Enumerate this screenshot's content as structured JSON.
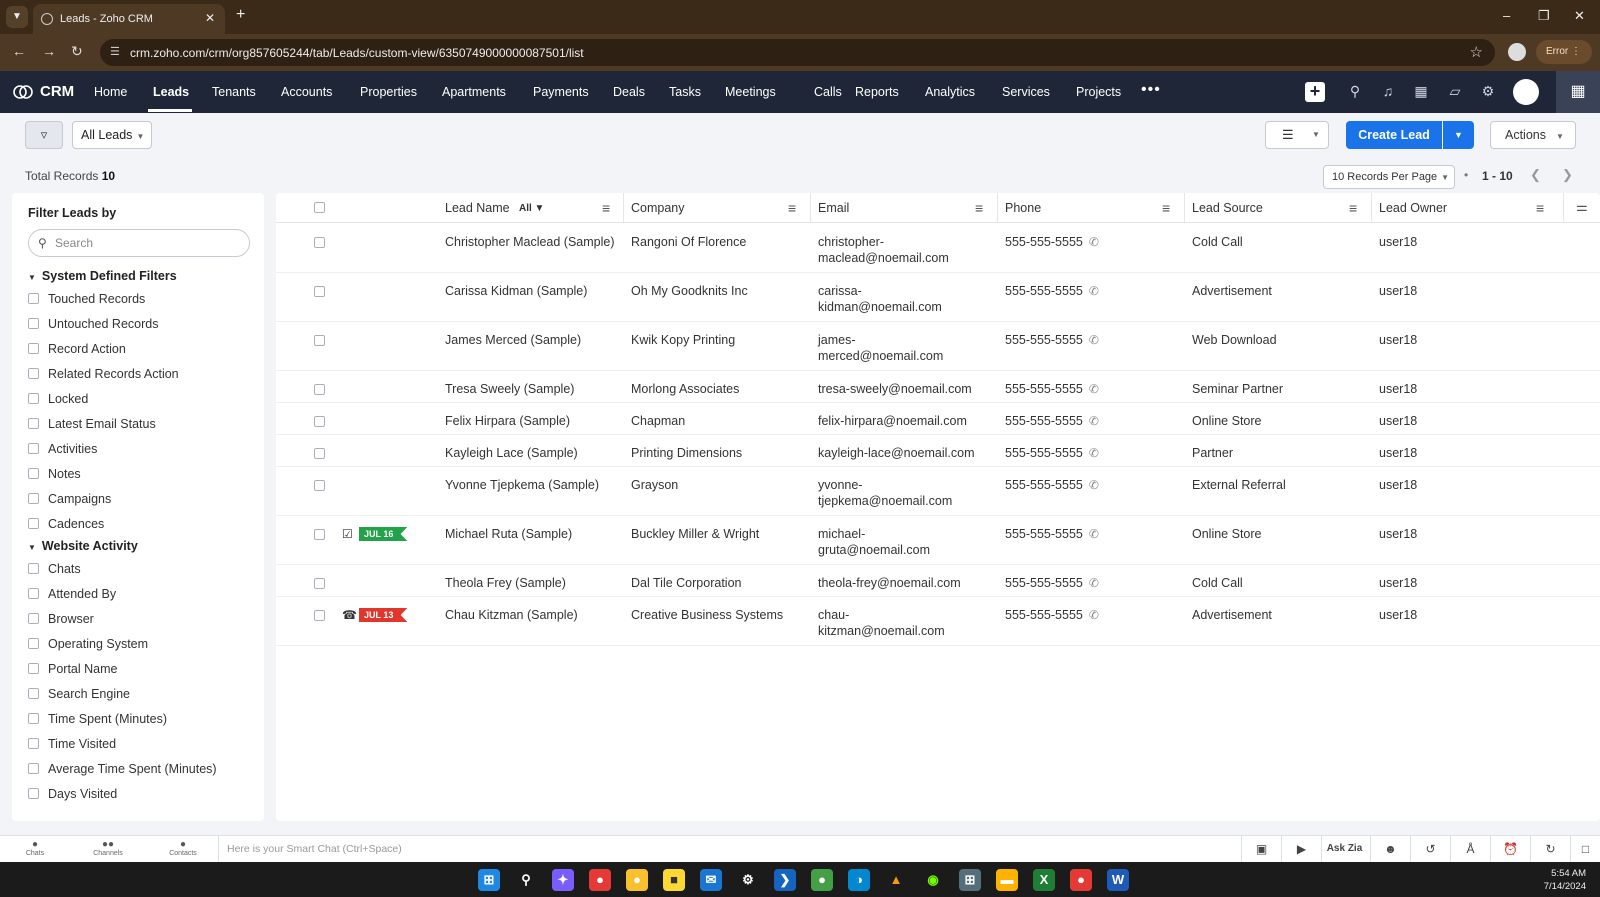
{
  "browser": {
    "tab_title": "Leads - Zoho CRM",
    "url": "crm.zoho.com/crm/org857605244/tab/Leads/custom-view/6350749000000087501/list",
    "error_label": "Error"
  },
  "crm": {
    "brand": "CRM",
    "nav": [
      {
        "label": "Home"
      },
      {
        "label": "Leads"
      },
      {
        "label": "Tenants"
      },
      {
        "label": "Accounts"
      },
      {
        "label": "Properties"
      },
      {
        "label": "Apartments"
      },
      {
        "label": "Payments"
      },
      {
        "label": "Deals"
      },
      {
        "label": "Tasks"
      },
      {
        "label": "Meetings"
      },
      {
        "label": "Calls"
      },
      {
        "label": "Reports"
      },
      {
        "label": "Analytics"
      },
      {
        "label": "Services"
      },
      {
        "label": "Projects"
      }
    ],
    "active_nav": "Leads"
  },
  "toolbar": {
    "view_label": "All Leads",
    "create_label": "Create Lead",
    "actions_label": "Actions",
    "total_label": "Total Records",
    "total_count": "10",
    "per_page": "10 Records Per Page",
    "page_range": "1 - 10"
  },
  "sidebar": {
    "title": "Filter Leads by",
    "search_placeholder": "Search",
    "sections": [
      {
        "title": "System Defined Filters",
        "items": [
          "Touched Records",
          "Untouched Records",
          "Record Action",
          "Related Records Action",
          "Locked",
          "Latest Email Status",
          "Activities",
          "Notes",
          "Campaigns",
          "Cadences"
        ]
      },
      {
        "title": "Website Activity",
        "items": [
          "Chats",
          "Attended By",
          "Browser",
          "Operating System",
          "Portal Name",
          "Search Engine",
          "Time Spent (Minutes)",
          "Time Visited",
          "Average Time Spent (Minutes)",
          "Days Visited"
        ]
      }
    ]
  },
  "table": {
    "columns": [
      "Lead Name",
      "Company",
      "Email",
      "Phone",
      "Lead Source",
      "Lead Owner"
    ],
    "name_filter": "All",
    "rows": [
      {
        "name": "Christopher Maclead (Sample)",
        "company": "Rangoni Of Florence",
        "email1": "christopher-",
        "email2": "maclead@noemail.com",
        "phone": "555-555-5555",
        "source": "Cold Call",
        "owner": "user18",
        "badge": ""
      },
      {
        "name": "Carissa Kidman (Sample)",
        "company": "Oh My Goodknits Inc",
        "email1": "carissa-",
        "email2": "kidman@noemail.com",
        "phone": "555-555-5555",
        "source": "Advertisement",
        "owner": "user18",
        "badge": ""
      },
      {
        "name": "James Merced (Sample)",
        "company": "Kwik Kopy Printing",
        "email1": "james-",
        "email2": "merced@noemail.com",
        "phone": "555-555-5555",
        "source": "Web Download",
        "owner": "user18",
        "badge": ""
      },
      {
        "name": "Tresa Sweely (Sample)",
        "company": "Morlong Associates",
        "email1": "tresa-sweely@noemail.com",
        "email2": "",
        "phone": "555-555-5555",
        "source": "Seminar Partner",
        "owner": "user18",
        "badge": ""
      },
      {
        "name": "Felix Hirpara (Sample)",
        "company": "Chapman",
        "email1": "felix-hirpara@noemail.com",
        "email2": "",
        "phone": "555-555-5555",
        "source": "Online Store",
        "owner": "user18",
        "badge": ""
      },
      {
        "name": "Kayleigh Lace (Sample)",
        "company": "Printing Dimensions",
        "email1": "kayleigh-lace@noemail.com",
        "email2": "",
        "phone": "555-555-5555",
        "source": "Partner",
        "owner": "user18",
        "badge": ""
      },
      {
        "name": "Yvonne Tjepkema (Sample)",
        "company": "Grayson",
        "email1": "yvonne-",
        "email2": "tjepkema@noemail.com",
        "phone": "555-555-5555",
        "source": "External Referral",
        "owner": "user18",
        "badge": ""
      },
      {
        "name": "Michael Ruta (Sample)",
        "company": "Buckley Miller & Wright",
        "email1": "michael-",
        "email2": "gruta@noemail.com",
        "phone": "555-555-5555",
        "source": "Online Store",
        "owner": "user18",
        "badge": "JUL 16"
      },
      {
        "name": "Theola Frey (Sample)",
        "company": "Dal Tile Corporation",
        "email1": "theola-frey@noemail.com",
        "email2": "",
        "phone": "555-555-5555",
        "source": "Cold Call",
        "owner": "user18",
        "badge": ""
      },
      {
        "name": "Chau Kitzman (Sample)",
        "company": "Creative Business Systems",
        "email1": "chau-",
        "email2": "kitzman@noemail.com",
        "phone": "555-555-5555",
        "source": "Advertisement",
        "owner": "user18",
        "badge": "JUL 13"
      }
    ]
  },
  "bottombar": {
    "chats": "Chats",
    "channels": "Channels",
    "contacts": "Contacts",
    "smart_chat": "Here is your Smart Chat (Ctrl+Space)",
    "ask_zia": "Ask Zia"
  },
  "taskbar": {
    "time": "5:54 AM",
    "date": "7/14/2024"
  },
  "colors": {
    "nav_bg": "#1e2638",
    "accent": "#1a73e8",
    "badge_green": "#22a34a",
    "badge_red": "#e0362c"
  }
}
